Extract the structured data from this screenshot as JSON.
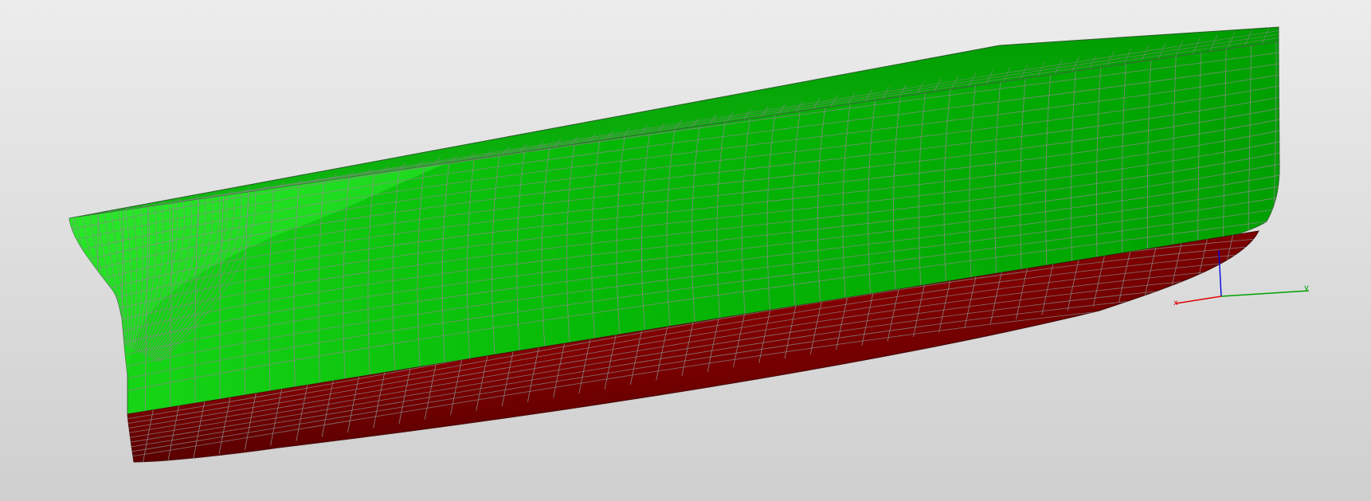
{
  "viewport": {
    "background_top": "#ececec",
    "background_bottom": "#cfcfcf"
  },
  "model": {
    "hull_color_above_waterline": "#00b400",
    "hull_color_below_waterline": "#b40000",
    "mesh_line_color": "#8a8a8a"
  },
  "axes": {
    "x_label": "x",
    "y_label": "y",
    "x_color": "#e00000",
    "y_color": "#00a000",
    "z_color": "#0000dd"
  }
}
